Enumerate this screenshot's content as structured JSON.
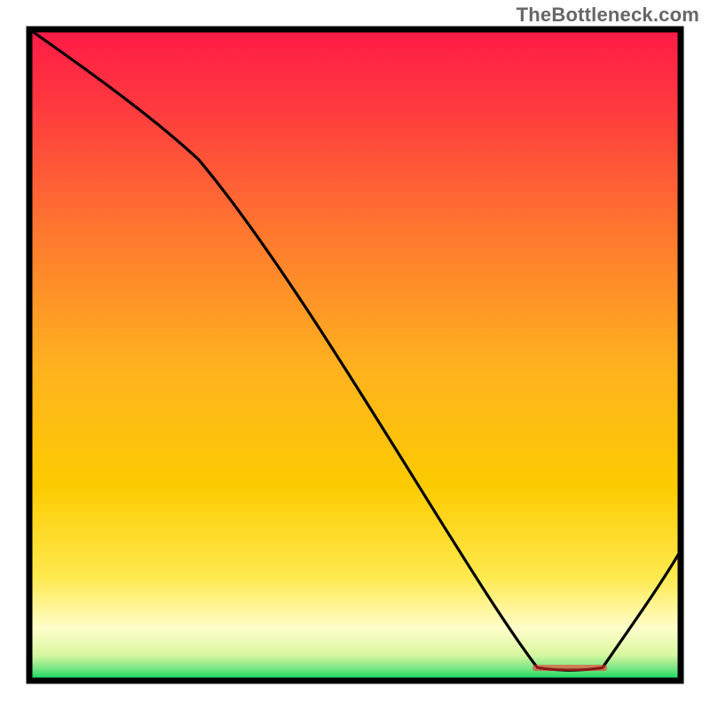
{
  "attribution": "TheBottleneck.com",
  "chart_data": {
    "type": "line",
    "title": "",
    "xlabel": "",
    "ylabel": "",
    "xlim": [
      0,
      100
    ],
    "ylim": [
      0,
      100
    ],
    "grid": false,
    "legend": false,
    "background_gradient": {
      "top_color": "#ff1a47",
      "mid_color": "#fccb00",
      "lower_color": "#fffecb",
      "bottom_color": "#00d656"
    },
    "x": [
      0,
      26,
      78,
      88,
      100
    ],
    "values": [
      100,
      80,
      2,
      2,
      20
    ],
    "notes": "Single black curve on a vertical red-to-green gradient. Curve starts at the top-left corner, descends with a slight slope change around x≈26, reaches a near-zero minimum between x≈78 and x≈88, then rises toward the right edge. A faint short red horizontal mark sits at the flat minimum near the bottom."
  }
}
